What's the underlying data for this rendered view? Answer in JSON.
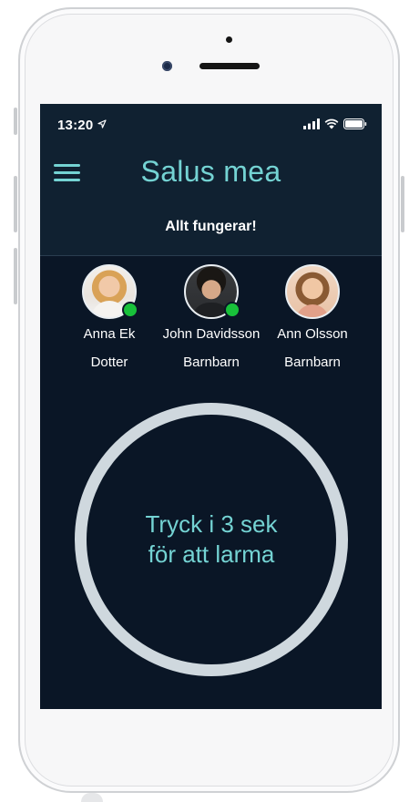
{
  "status_bar": {
    "time": "13:20"
  },
  "header": {
    "title": "Salus mea",
    "status_message": "Allt fungerar!"
  },
  "contacts": [
    {
      "name": "Anna Ek",
      "relation": "Dotter",
      "online": true
    },
    {
      "name": "John Davidsson",
      "relation": "Barnbarn",
      "online": true
    },
    {
      "name": "Ann Olsson",
      "relation": "Barnbarn",
      "online": false
    }
  ],
  "alarm_button": {
    "line1": "Tryck i 3 sek",
    "line2": "för att larma"
  },
  "colors": {
    "accent": "#74d3d3",
    "background": "#0a1626",
    "header_background": "#102131",
    "online": "#18c13a",
    "ring": "#cfd8de"
  },
  "icons": [
    "location-arrow-icon",
    "signal-icon",
    "wifi-icon",
    "battery-icon",
    "menu-icon"
  ]
}
